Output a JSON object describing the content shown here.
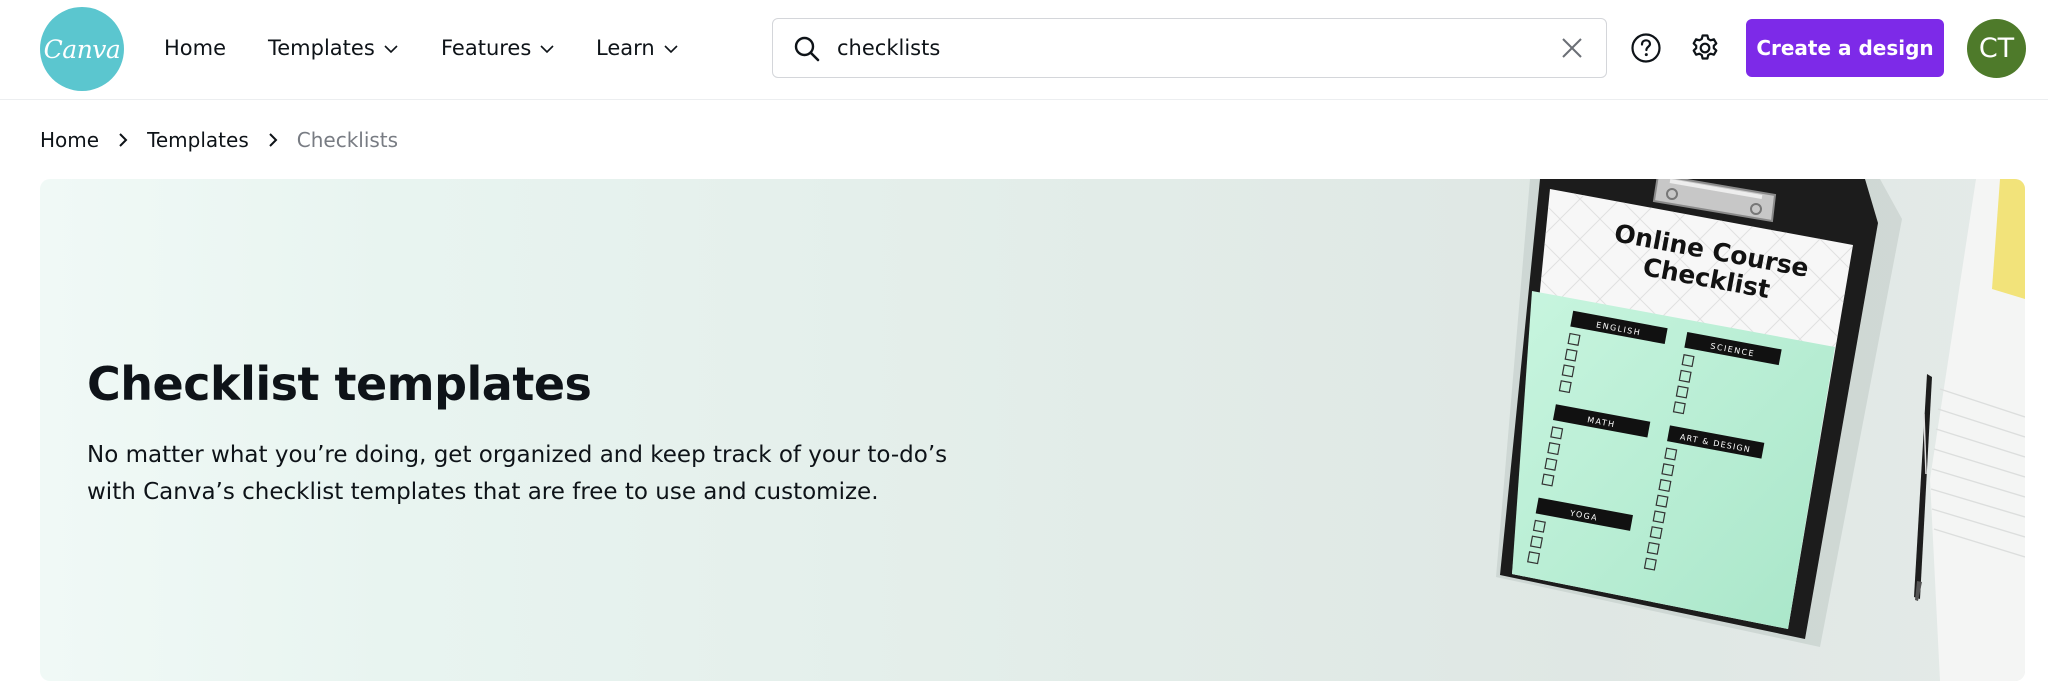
{
  "brand": {
    "logo_text": "Canva",
    "accent": "#7d2ae8",
    "logo_color": "#5bc6cf"
  },
  "nav": {
    "items": [
      {
        "label": "Home"
      },
      {
        "label": "Templates"
      },
      {
        "label": "Features"
      },
      {
        "label": "Learn"
      }
    ]
  },
  "search": {
    "value": "checklists",
    "icon": "search-icon",
    "clear_icon": "close-icon"
  },
  "toolbar": {
    "help_icon": "help-icon",
    "settings_icon": "gear-icon",
    "create_label": "Create a design"
  },
  "user": {
    "initials": "CT",
    "avatar_color": "#4e7a2a"
  },
  "breadcrumb": [
    {
      "label": "Home"
    },
    {
      "label": "Templates"
    },
    {
      "label": "Checklists"
    }
  ],
  "hero": {
    "title": "Checklist templates",
    "description": "No matter what you’re doing, get organized and keep track of your to-do’s with Canva’s checklist templates that are free to use and customize.",
    "image": {
      "title_line1": "Online Course",
      "title_line2": "Checklist",
      "sections": [
        "ENGLISH",
        "SCIENCE",
        "MATH",
        "ART & DESIGN",
        "YOGA"
      ]
    }
  }
}
